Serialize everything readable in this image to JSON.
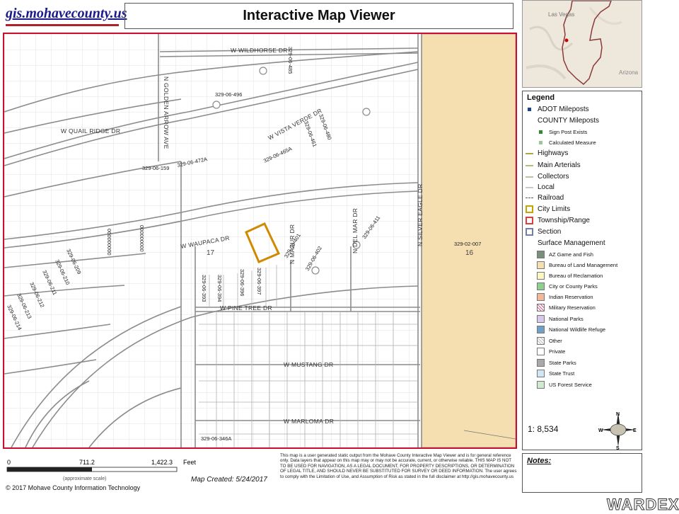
{
  "header": {
    "site": "gis.mohavecounty.us",
    "title": "Interactive Map Viewer"
  },
  "overview": {
    "labels": [
      "Las Vegas",
      "Arizona"
    ]
  },
  "map": {
    "streets": [
      {
        "id": "wildhorse",
        "label": "W WILDHORSE DR"
      },
      {
        "id": "quailridge",
        "label": "W QUAIL RIDGE DR"
      },
      {
        "id": "vistaverde",
        "label": "W VISTA VERDE DR"
      },
      {
        "id": "goldenarrow",
        "label": "N GOLDEN ARROW AVE"
      },
      {
        "id": "waupaca",
        "label": "W WAUPACA DR"
      },
      {
        "id": "pinetree",
        "label": "W PINE TREE DR"
      },
      {
        "id": "mustang",
        "label": "W MUSTANG DR"
      },
      {
        "id": "marloma",
        "label": "W MARLOMA DR"
      },
      {
        "id": "silvereagle",
        "label": "N SILVER EAGLE DR"
      },
      {
        "id": "mazur",
        "label": "N MAZUR DR"
      },
      {
        "id": "delmar",
        "label": "N DEL MAR DR"
      }
    ],
    "parcels": [
      "329-06-485",
      "329-06-496",
      "329-06-480",
      "329-06-461",
      "329-06-465A",
      "329-06-159",
      "329-06-472A",
      "329-06-401",
      "329-06-402",
      "329-06-411",
      "329-06-393",
      "329-06-394",
      "329-06-396",
      "329-06-397",
      "329-06-209",
      "329-06-210",
      "329-06-211",
      "329-06-212",
      "329-06-213",
      "329-06-214",
      "329-06-346A",
      "329-02-007"
    ],
    "section_numbers": [
      "17",
      "16"
    ],
    "zeros_label": "000000000"
  },
  "legend": {
    "title": "Legend",
    "items": [
      {
        "label": "ADOT Mileposts",
        "kind": "dot",
        "color": "#1f3f8f",
        "small": false
      },
      {
        "label": "COUNTY Mileposts",
        "kind": "none",
        "color": "",
        "small": false
      },
      {
        "label": "Sign Post Exists",
        "kind": "dot",
        "color": "#2e8b2e",
        "small": true
      },
      {
        "label": "Calculated Measure",
        "kind": "dot",
        "color": "#9bc59b",
        "small": true
      },
      {
        "label": "Highways",
        "kind": "line",
        "color": "#b5a34a",
        "small": false
      },
      {
        "label": "Main Arterials",
        "kind": "line",
        "color": "#a8c27a",
        "small": false
      },
      {
        "label": "Collectors",
        "kind": "line",
        "color": "#b5c7a0",
        "small": false
      },
      {
        "label": "Local",
        "kind": "line",
        "color": "#c9c9c9",
        "small": false
      },
      {
        "label": "Railroad",
        "kind": "rail",
        "color": "#555555",
        "small": false
      },
      {
        "label": "City Limits",
        "kind": "box",
        "color": "#c9a400",
        "small": false
      },
      {
        "label": "Township/Range",
        "kind": "box",
        "color": "#d94040",
        "small": false
      },
      {
        "label": "Section",
        "kind": "box",
        "color": "#6f7fa8",
        "small": false
      },
      {
        "label": "Surface Management",
        "kind": "none",
        "color": "",
        "small": false
      },
      {
        "label": "AZ Game and Fish",
        "kind": "fill",
        "color": "#7a8f7a",
        "small": true
      },
      {
        "label": "Bureau of Land Management",
        "kind": "fill",
        "color": "#f5deb0",
        "small": true
      },
      {
        "label": "Bureau of Reclamation",
        "kind": "fill",
        "color": "#fbf6c2",
        "small": true
      },
      {
        "label": "City or County Parks",
        "kind": "fill",
        "color": "#8fd08f",
        "small": true
      },
      {
        "label": "Indian Reservation",
        "kind": "fill",
        "color": "#f3b89a",
        "small": true
      },
      {
        "label": "Military Reservation",
        "kind": "hatch",
        "color": "#d05a8a",
        "small": true
      },
      {
        "label": "National Parks",
        "kind": "fill",
        "color": "#d8c8ec",
        "small": true
      },
      {
        "label": "National Wildlife Refuge",
        "kind": "fill",
        "color": "#6fa0c8",
        "small": true
      },
      {
        "label": "Other",
        "kind": "hatch",
        "color": "#bbbbbb",
        "small": true
      },
      {
        "label": "Private",
        "kind": "fill",
        "color": "#ffffff",
        "small": true
      },
      {
        "label": "State Parks",
        "kind": "fill",
        "color": "#a9a9a9",
        "small": true
      },
      {
        "label": "State Trust",
        "kind": "fill",
        "color": "#cfe6f5",
        "small": true
      },
      {
        "label": "US Forest Service",
        "kind": "fill",
        "color": "#cfeacc",
        "small": true
      }
    ]
  },
  "scale": {
    "ratio": "1: 8,534",
    "compass": [
      "N",
      "E",
      "S",
      "W"
    ]
  },
  "scalebar": {
    "ticks": [
      "0",
      "711.2",
      "1,422.3"
    ],
    "unit": "Feet",
    "note": "(approximate scale)"
  },
  "footer": {
    "copyright": "© 2017 Mohave County Information Technology",
    "created": "Map Created: 5/24/2017",
    "disclaimer": "This map is a user generated static output from the Mohave County Interactive Map Viewer and is for general reference only. Data layers that appear on this map may or may not be accurate, current, or otherwise reliable. THIS MAP IS NOT TO BE USED FOR NAVIGATION, AS A LEGAL DOCUMENT, FOR PROPERTY DESCRIPTIONS, OR DETERMINATION OF LEGAL TITLE, AND SHOULD NEVER BE SUBSTITUTED FOR SURVEY OR DEED INFORMATION. The user agrees to comply with the Limitation of Use, and Assumption of Risk as stated in the full disclaimer at http://gis.mohavecounty.us"
  },
  "notes": {
    "label": "Notes:"
  },
  "watermark": "WARDEX",
  "colors": {
    "frame": "#c8102e",
    "blm": "#f5deb0",
    "highlight": "#d08a00"
  }
}
